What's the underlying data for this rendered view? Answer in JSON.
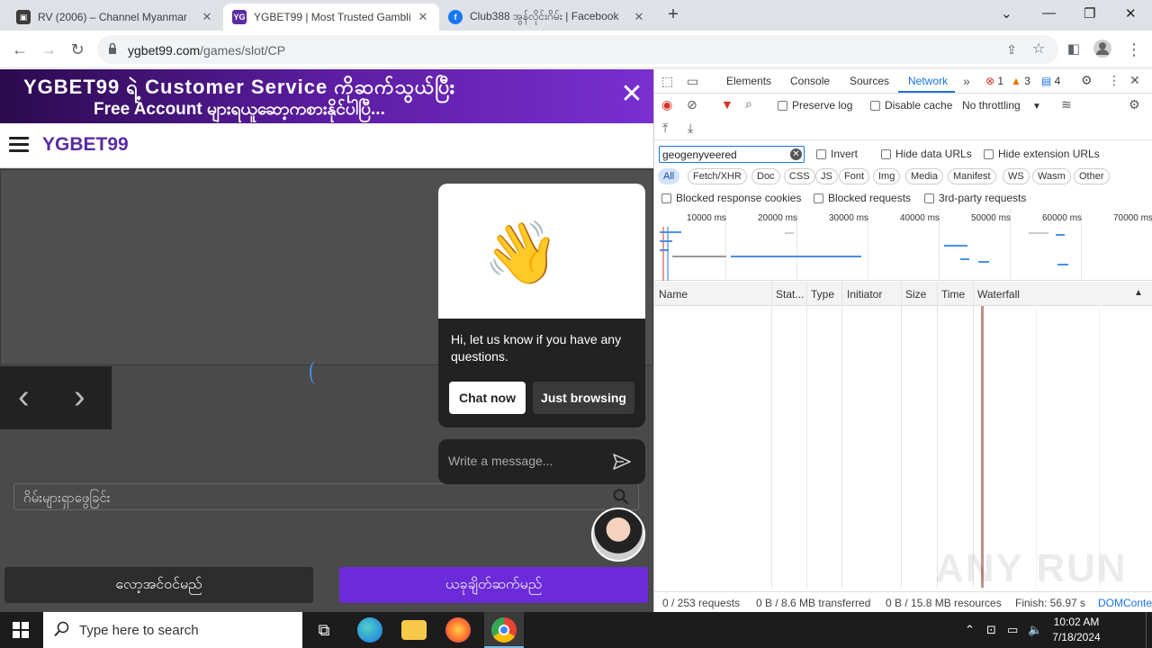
{
  "browser": {
    "tabs": [
      {
        "title": "RV (2006) – Channel Myanmar",
        "favicon_color": "#3b3b3b"
      },
      {
        "title": "YGBET99 | Most Trusted Gamblin",
        "favicon_text": "YG",
        "favicon_color": "#5a2ca0"
      },
      {
        "title": "Club388 အွန်လိုင်းဂိမ်း | Facebook",
        "favicon_color": "#1877f2"
      }
    ],
    "new_tab": "+",
    "url_host": "ygbet99.com",
    "url_path": "/games/slot/CP",
    "window_controls": [
      "chevron-down",
      "minimize",
      "restore",
      "close"
    ]
  },
  "page": {
    "banner_line1": "YGBET99 ရဲ့ Customer Service ကိုဆက်သွယ်ပြီး",
    "banner_line2": "Free Account များရယူဆော့ကစားနိုင်ပါပြီ...",
    "banner_close": "✕",
    "logo": "YGBET99",
    "prev": "‹",
    "next": "›",
    "search_placeholder": "ဂိမ်းများရှာဖွေခြင်း",
    "login_button": "လော့အင်ဝင်မည်",
    "register_button": "ယခုချိတ်ဆက်မည်"
  },
  "chat": {
    "greeting": "Hi, let us know if you have any questions.",
    "chat_now": "Chat now",
    "just_browsing": "Just browsing",
    "input_placeholder": "Write a message..."
  },
  "devtools": {
    "tabs": [
      "Elements",
      "Console",
      "Sources",
      "Network"
    ],
    "active_tab": "Network",
    "errors": "1",
    "warnings": "3",
    "messages": "4",
    "preserve_log": "Preserve log",
    "disable_cache": "Disable cache",
    "throttling": "No throttling",
    "filter_value": "geogenyveered",
    "invert": "Invert",
    "hide_data_urls": "Hide data URLs",
    "hide_extension_urls": "Hide extension URLs",
    "type_filters": [
      "All",
      "Fetch/XHR",
      "Doc",
      "CSS",
      "JS",
      "Font",
      "Img",
      "Media",
      "Manifest",
      "WS",
      "Wasm",
      "Other"
    ],
    "blocked_cookies": "Blocked response cookies",
    "blocked_requests": "Blocked requests",
    "third_party": "3rd-party requests",
    "overview_ticks": [
      "10000 ms",
      "20000 ms",
      "30000 ms",
      "40000 ms",
      "50000 ms",
      "60000 ms",
      "70000 ms"
    ],
    "columns": [
      "Name",
      "Stat...",
      "Type",
      "Initiator",
      "Size",
      "Time",
      "Waterfall"
    ],
    "status_requests": "0 / 253 requests",
    "status_transferred": "0 B / 8.6 MB transferred",
    "status_resources": "0 B / 15.8 MB resources",
    "status_finish": "Finish: 56.97 s",
    "status_dom": "DOMConte",
    "watermark": "ANY RUN"
  },
  "taskbar": {
    "search_placeholder": "Type here to search",
    "time": "10:02 AM",
    "date": "7/18/2024"
  }
}
